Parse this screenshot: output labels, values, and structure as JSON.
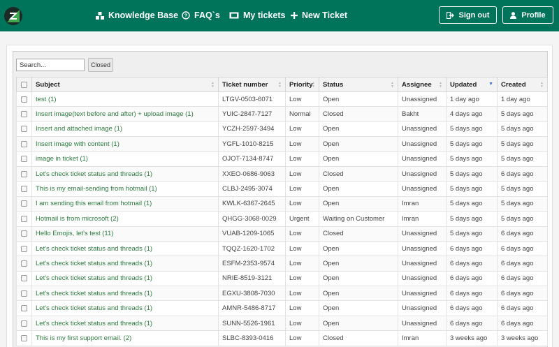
{
  "nav": {
    "knowledge_base": "Knowledge Base",
    "faqs": "FAQ`s",
    "my_tickets": "My tickets",
    "new_ticket": "New Ticket",
    "sign_out": "Sign out",
    "profile": "Profile"
  },
  "colors": {
    "header": "#00735b",
    "link": "#2c7b3f"
  },
  "search": {
    "placeholder": "Search...",
    "value": ""
  },
  "filter": {
    "closed_label": "Closed"
  },
  "table": {
    "columns": {
      "subject": "Subject",
      "ticket_number": "Ticket number",
      "priority": "Priority",
      "status": "Status",
      "assignee": "Assignee",
      "updated": "Updated",
      "created": "Created"
    },
    "rows": [
      {
        "subject": "test (1)",
        "ticket": "LTGV-0503-6071",
        "priority": "Low",
        "status": "Open",
        "assignee": "Unassigned",
        "updated": "1 day ago",
        "created": "1 day ago"
      },
      {
        "subject": "Insert image(text before and after) + upload image (1)",
        "ticket": "YUIC-2847-7127",
        "priority": "Normal",
        "status": "Closed",
        "assignee": "Bakht",
        "updated": "4 days ago",
        "created": "5 days ago"
      },
      {
        "subject": "Insert and attached image (1)",
        "ticket": "YCZH-2597-3494",
        "priority": "Low",
        "status": "Open",
        "assignee": "Unassigned",
        "updated": "5 days ago",
        "created": "5 days ago"
      },
      {
        "subject": "Insert image with content (1)",
        "ticket": "YGFL-1010-8215",
        "priority": "Low",
        "status": "Open",
        "assignee": "Unassigned",
        "updated": "5 days ago",
        "created": "5 days ago"
      },
      {
        "subject": "image in ticket (1)",
        "ticket": "OJOT-7134-8747",
        "priority": "Low",
        "status": "Open",
        "assignee": "Unassigned",
        "updated": "5 days ago",
        "created": "5 days ago"
      },
      {
        "subject": "Let's check ticket status and threads (1)",
        "ticket": "XXEO-0686-9063",
        "priority": "Low",
        "status": "Closed",
        "assignee": "Unassigned",
        "updated": "5 days ago",
        "created": "6 days ago"
      },
      {
        "subject": "This is my email-sending from hotmail (1)",
        "ticket": "CLBJ-2495-3074",
        "priority": "Low",
        "status": "Open",
        "assignee": "Unassigned",
        "updated": "5 days ago",
        "created": "5 days ago"
      },
      {
        "subject": "I am sending this email from hotmail (1)",
        "ticket": "KWLK-6367-2645",
        "priority": "Low",
        "status": "Open",
        "assignee": "Imran",
        "updated": "5 days ago",
        "created": "5 days ago"
      },
      {
        "subject": "Hotmail is from microsoft (2)",
        "ticket": "QHGG-3068-0029",
        "priority": "Urgent",
        "status": "Waiting on Customer",
        "assignee": "Imran",
        "updated": "5 days ago",
        "created": "5 days ago"
      },
      {
        "subject": "Hello Emojis, let's test (11)",
        "ticket": "VUAB-1209-1065",
        "priority": "Low",
        "status": "Closed",
        "assignee": "Unassigned",
        "updated": "5 days ago",
        "created": "6 days ago"
      },
      {
        "subject": "Let's check ticket status and threads (1)",
        "ticket": "TQQZ-1620-1702",
        "priority": "Low",
        "status": "Open",
        "assignee": "Unassigned",
        "updated": "6 days ago",
        "created": "6 days ago"
      },
      {
        "subject": "Let's check ticket status and threads (1)",
        "ticket": "ESFM-2353-9574",
        "priority": "Low",
        "status": "Open",
        "assignee": "Unassigned",
        "updated": "6 days ago",
        "created": "6 days ago"
      },
      {
        "subject": "Let's check ticket status and threads (1)",
        "ticket": "NRIE-8519-3121",
        "priority": "Low",
        "status": "Open",
        "assignee": "Unassigned",
        "updated": "6 days ago",
        "created": "6 days ago"
      },
      {
        "subject": "Let's check ticket status and threads (1)",
        "ticket": "EGXU-3808-7030",
        "priority": "Low",
        "status": "Open",
        "assignee": "Unassigned",
        "updated": "6 days ago",
        "created": "6 days ago"
      },
      {
        "subject": "Let's check ticket status and threads (1)",
        "ticket": "AMNR-5486-8717",
        "priority": "Low",
        "status": "Open",
        "assignee": "Unassigned",
        "updated": "6 days ago",
        "created": "6 days ago"
      },
      {
        "subject": "Let's check ticket status and threads (1)",
        "ticket": "SUNN-5526-1961",
        "priority": "Low",
        "status": "Open",
        "assignee": "Unassigned",
        "updated": "6 days ago",
        "created": "6 days ago"
      },
      {
        "subject": "This is my first support email. (2)",
        "ticket": "SLBC-8393-0416",
        "priority": "Low",
        "status": "Closed",
        "assignee": "Imran",
        "updated": "3 weeks ago",
        "created": "3 weeks ago"
      }
    ]
  }
}
